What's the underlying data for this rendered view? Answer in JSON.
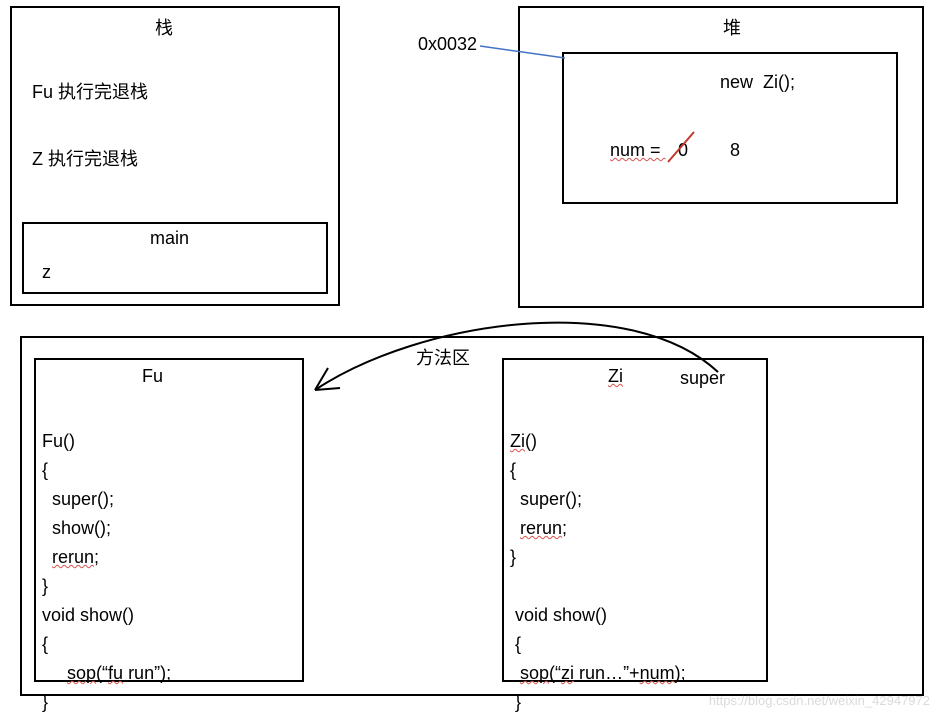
{
  "stack": {
    "title": "栈",
    "line1": "Fu 执行完退栈",
    "line2": "Z 执行完退栈",
    "frame_label": "main",
    "frame_var": "z"
  },
  "heap": {
    "title": "堆",
    "address": "0x0032",
    "obj_new": "new  Zi();",
    "num_label": "num = ",
    "num_old": "0",
    "num_new": "8"
  },
  "method_area": {
    "title": "方法区",
    "super_label": "super",
    "fu": {
      "name": "Fu",
      "code": "Fu()\n{\n  super();\n  show();\n  rerun;\n}\nvoid show()\n{\n     sop(\"fu run\");\n}"
    },
    "zi": {
      "name": "Zi",
      "code": "Zi()\n{\n  super();\n  rerun;\n}\n\n void show()\n {\n  sop(\"zi run…\"+num);\n }"
    }
  },
  "watermark": "https://blog.csdn.net/weixin_42947972"
}
